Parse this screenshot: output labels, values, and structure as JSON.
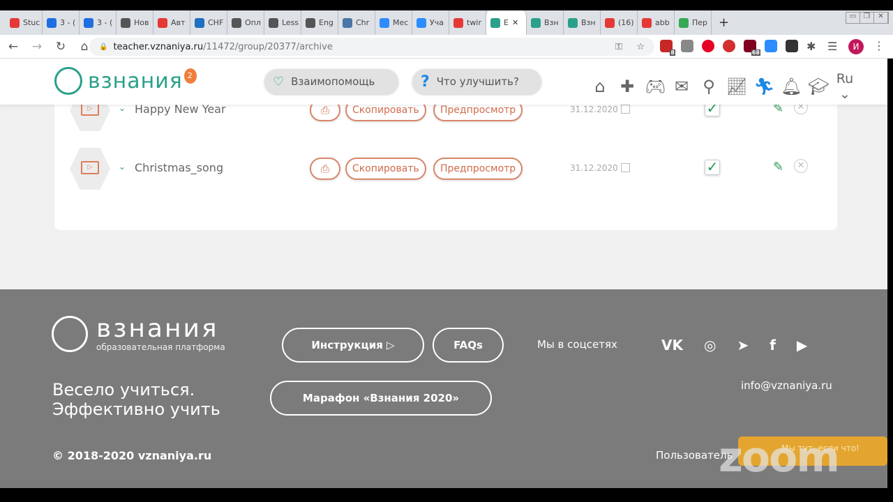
{
  "browser": {
    "tabs": [
      {
        "label": "Stuc",
        "color": "#e53935"
      },
      {
        "label": "3 - (",
        "color": "#1e6fe0"
      },
      {
        "label": "3 - (",
        "color": "#1e6fe0"
      },
      {
        "label": "Нов",
        "color": "#555"
      },
      {
        "label": "Авт",
        "color": "#e53935"
      },
      {
        "label": "CHF",
        "color": "#1e70c0"
      },
      {
        "label": "Опл",
        "color": "#555"
      },
      {
        "label": "Less",
        "color": "#555"
      },
      {
        "label": "Eng",
        "color": "#555"
      },
      {
        "label": "Chr",
        "color": "#4a76a8"
      },
      {
        "label": "Мес",
        "color": "#2d8cff"
      },
      {
        "label": "Уча",
        "color": "#2d8cff"
      },
      {
        "label": "twir",
        "color": "#e53935"
      },
      {
        "label": "E",
        "color": "#2aa08a",
        "active": true
      },
      {
        "label": "Взн",
        "color": "#2aa08a"
      },
      {
        "label": "Взн",
        "color": "#2aa08a"
      },
      {
        "label": "(16)",
        "color": "#e53935"
      },
      {
        "label": "abb",
        "color": "#e53935"
      },
      {
        "label": "Пер",
        "color": "#34a853"
      }
    ],
    "url_host": "teacher.vznaniya.ru",
    "url_path": "/11472/group/20377/archive",
    "ext_badges": [
      "8",
      "68"
    ],
    "profile_initial": "И"
  },
  "header": {
    "logo": "взнания",
    "balloon": "2",
    "mutual_help": "Взаимопомощь",
    "improve": "Что улучшить?",
    "lang": "Ru"
  },
  "lessons": [
    {
      "title": "Happy New Year",
      "copy": "Скопировать",
      "preview": "Предпросмотр",
      "date": "31.12.2020",
      "checked": true
    },
    {
      "title": "Christmas_song",
      "copy": "Скопировать",
      "preview": "Предпросмотр",
      "date": "31.12.2020",
      "checked": true
    }
  ],
  "footer": {
    "logo": "взнания",
    "logo_sub": "образовательная платформа",
    "slogan1": "Весело учиться.",
    "slogan2": "Эффективно учить",
    "instructions": "Инструкция",
    "faqs": "FAQs",
    "marathon": "Марафон «Взнания 2020»",
    "social_label": "Мы в соцсетях",
    "social": [
      "VK",
      "◎",
      "➤",
      "f",
      "▶"
    ],
    "email": "info@vznaniya.ru",
    "copyright": "© 2018-2020 vznaniya.ru",
    "user_agreement": "Пользователь",
    "zoom_watermark": "zoom",
    "notice": "Мы тут, если что!"
  }
}
